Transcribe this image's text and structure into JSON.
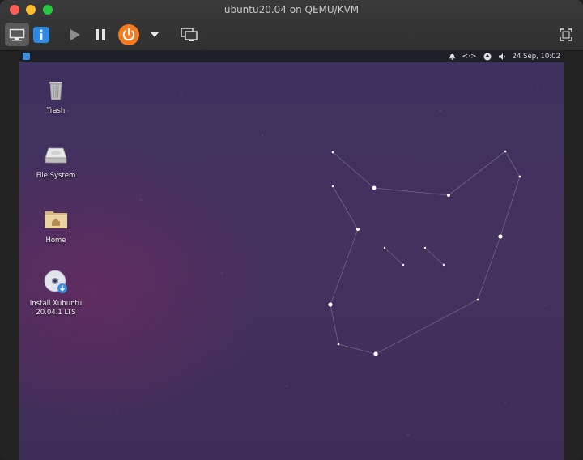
{
  "window": {
    "title": "ubuntu20.04 on QEMU/KVM"
  },
  "toolbar": {
    "display_icon": "monitor-icon",
    "info_icon": "info-icon",
    "play_icon": "play-icon",
    "pause_icon": "pause-icon",
    "power_icon": "power-icon",
    "dropdown_icon": "chevron-down-icon",
    "screens_icon": "snapshots-icon",
    "fullscreen_icon": "fullscreen-icon",
    "power_color": "#f47b20",
    "info_color": "#2f8ae6"
  },
  "panel": {
    "datetime": "24 Sep, 10:02",
    "network_label": "<·>",
    "icons": [
      "bell-icon",
      "network-icon",
      "updates-icon",
      "volume-icon"
    ]
  },
  "desktop": {
    "icons": [
      {
        "label": "Trash",
        "icon": "trash-icon"
      },
      {
        "label": "File System",
        "icon": "drive-icon"
      },
      {
        "label": "Home",
        "icon": "folder-home-icon"
      },
      {
        "label": "Install Xubuntu 20.04.1 LTS",
        "icon": "install-disc-icon"
      }
    ]
  }
}
